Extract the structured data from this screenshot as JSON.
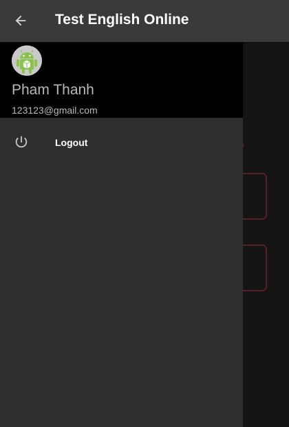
{
  "app_bar": {
    "title": "Test English Online",
    "back_icon": "arrow-left-icon"
  },
  "drawer": {
    "profile": {
      "name": "Pham Thanh",
      "email": "123123@gmail.com",
      "avatar_icon": "android-robot-icon"
    },
    "menu": [
      {
        "label": "Logout",
        "icon": "power-icon"
      }
    ]
  },
  "colors": {
    "app_bar": "#3a3a3a",
    "drawer_header": "#000000",
    "drawer_body": "#2f2f2f",
    "underlay_accent": "#5a1e26"
  }
}
